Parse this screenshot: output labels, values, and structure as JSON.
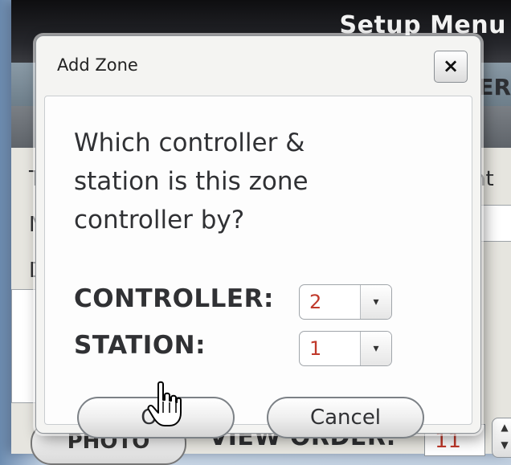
{
  "background_window": {
    "title": "Setup Menu",
    "tab_fragment": "ER",
    "left_letters": [
      "T",
      "N",
      "D"
    ],
    "right_fragment": "ht",
    "photo_button": "PHOTO",
    "view_order_label": "VIEW ORDER:",
    "view_order_value": "11"
  },
  "dialog": {
    "title": "Add Zone",
    "close_label": "×",
    "question_lines": [
      "Which controller &",
      "station is this zone",
      "controller by?"
    ],
    "controller_label": "CONTROLLER:",
    "controller_value": "2",
    "station_label": "STATION:",
    "station_value": "1",
    "dropdown_arrow": "▾",
    "ok_label": "OK",
    "cancel_label": "Cancel"
  },
  "icons": {
    "cursor": "hand-pointer-icon"
  },
  "colors": {
    "value_red": "#c0392b",
    "title_bar": "#1a1b1f"
  }
}
